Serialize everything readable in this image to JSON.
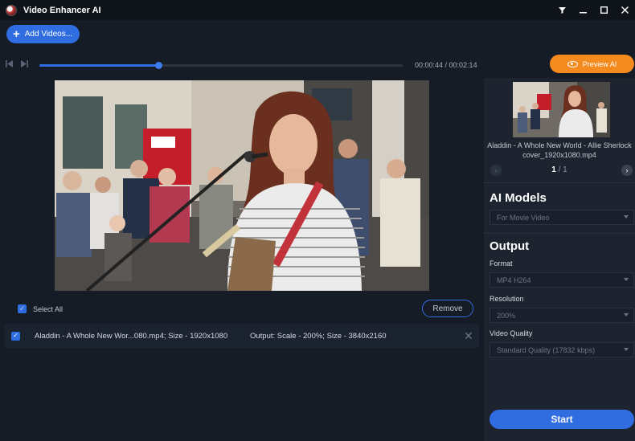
{
  "app": {
    "title": "Video Enhancer AI",
    "window_controls": [
      "filter-icon",
      "minimize-icon",
      "maximize-icon",
      "close-icon"
    ]
  },
  "toolbar": {
    "add_label": "Add Videos...",
    "preview_label": "Preview AI"
  },
  "player": {
    "time": "00:00:44 / 00:02:14",
    "progress": 0.3282
  },
  "list": {
    "select_all_label": "Select All",
    "remove_label": "Remove",
    "files": [
      {
        "name": "Aladdin - A Whole New Wor...080.mp4; Size - 1920x1080",
        "output": "Output: Scale - 200%; Size - 3840x2160"
      }
    ]
  },
  "panel": {
    "thumb_title": "Aladdin - A Whole New World - Allie Sherlock cover_1920x1080.mp4",
    "page_current": "1",
    "page_sep": " / ",
    "page_total": "1",
    "ai_models_title": "AI Models",
    "ai_model_value": "For Movie Video",
    "output_title": "Output",
    "format_label": "Format",
    "format_value": "MP4 H264",
    "resolution_label": "Resolution",
    "resolution_value": "200%",
    "quality_label": "Video Quality",
    "quality_value": "Standard Quality (17832 kbps)",
    "start_label": "Start"
  },
  "colors": {
    "accent": "#2f6de0",
    "preview": "#f58a1f",
    "background": "#161c26",
    "panel": "#1d2430"
  }
}
